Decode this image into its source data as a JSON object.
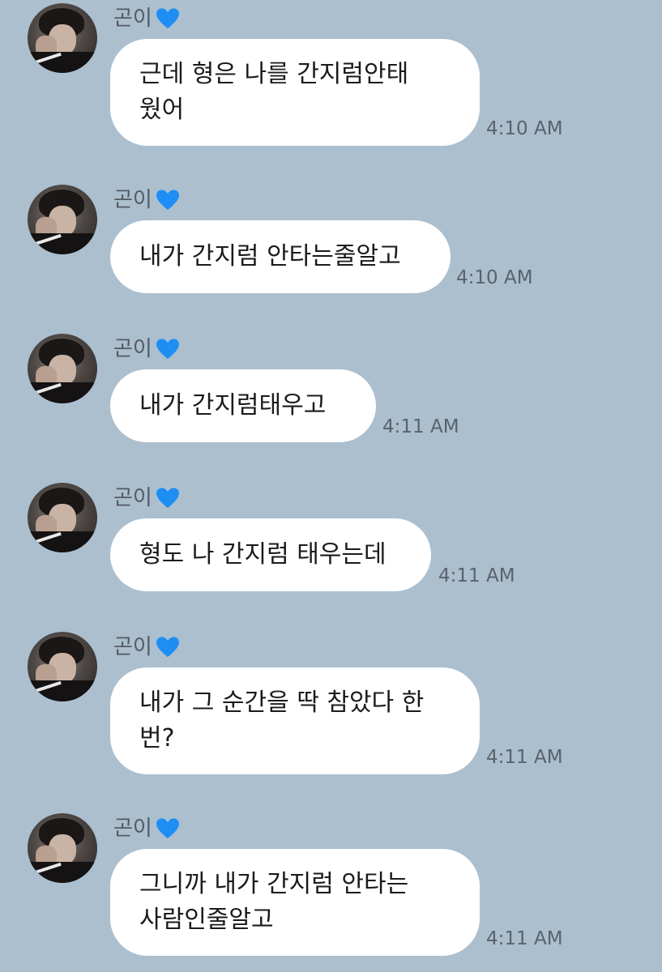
{
  "chat": {
    "sender_name": "곤이",
    "sender_badge_icon": "blue-heart-icon",
    "heart_color": "#1e8ef5",
    "messages": [
      {
        "text": "근데 형은 나를 간지럼안태\n웠어",
        "time": "4:10 AM"
      },
      {
        "text": "내가 간지럼 안타는줄알고",
        "time": "4:10 AM"
      },
      {
        "text": "내가 간지럼태우고",
        "time": "4:11 AM"
      },
      {
        "text": "형도 나 간지럼 태우는데",
        "time": "4:11 AM"
      },
      {
        "text": "내가 그 순간을 딱 참았다 한\n번?",
        "time": "4:11 AM"
      },
      {
        "text": "그니까 내가 간지럼 안타는\n사람인줄알고",
        "time": "4:11 AM"
      }
    ]
  }
}
